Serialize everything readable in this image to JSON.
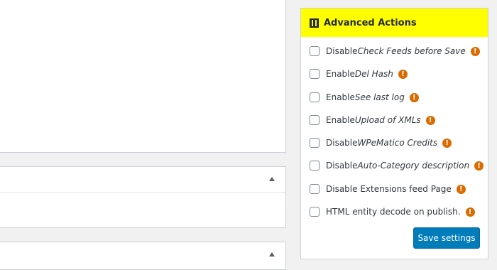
{
  "sidebar": {
    "title": "Advanced Actions",
    "options": [
      {
        "prefix": "Disable ",
        "name": "Check Feeds before Save",
        "suffix": "",
        "warning": "!"
      },
      {
        "prefix": "Enable ",
        "name": "Del Hash",
        "suffix": "",
        "warning": "!"
      },
      {
        "prefix": "Enable ",
        "name": "See last log",
        "suffix": "",
        "warning": "!"
      },
      {
        "prefix": "Enable ",
        "name": "Upload of XMLs",
        "suffix": "",
        "warning": "!"
      },
      {
        "prefix": "Disable ",
        "name": "WPeMatico Credits",
        "suffix": "",
        "warning": "!"
      },
      {
        "prefix": "Disable ",
        "name": "Auto-Category description",
        "suffix": "",
        "warning": "!"
      },
      {
        "prefix": "Disable Extensions feed Page",
        "name": "",
        "suffix": "",
        "warning": "!"
      },
      {
        "prefix": "HTML entity decode on publish.",
        "name": "",
        "suffix": "",
        "warning": "!"
      }
    ],
    "save_label": "Save settings"
  },
  "colors": {
    "header_highlight": "#ffff00",
    "warning": "#d96b00",
    "primary_button": "#007cba"
  },
  "icons": {
    "title": "sliders-icon",
    "warning": "exclamation-circle-icon",
    "panel_toggle": "triangle-up-icon"
  }
}
